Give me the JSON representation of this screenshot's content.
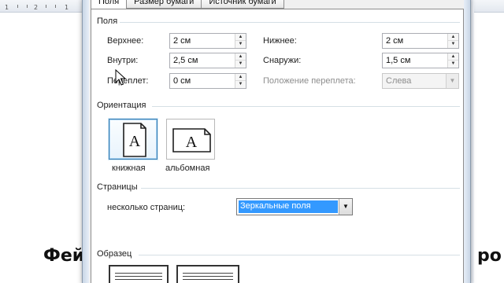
{
  "ruler": {
    "ticks": [
      "1",
      "2",
      "1"
    ]
  },
  "document": {
    "heading_left": "Фей",
    "heading_right": "ро"
  },
  "dialog": {
    "tabs": [
      {
        "label": "Поля",
        "active": true
      },
      {
        "label": "Размер бумаги",
        "active": false
      },
      {
        "label": "Источник бумаги",
        "active": false
      }
    ],
    "margins": {
      "title": "Поля",
      "top_label": "Верхнее:",
      "top_value": "2 см",
      "bottom_label": "Нижнее:",
      "bottom_value": "2 см",
      "inside_label": "Внутри:",
      "inside_value": "2,5 см",
      "outside_label": "Снаружи:",
      "outside_value": "1,5 см",
      "gutter_label": "Переплет:",
      "gutter_value": "0 см",
      "gutter_position_label": "Положение переплета:",
      "gutter_position_value": "Слева"
    },
    "orientation": {
      "title": "Ориентация",
      "portrait_label": "книжная",
      "landscape_label": "альбомная",
      "glyph": "A",
      "selected": "книжная"
    },
    "pages": {
      "title": "Страницы",
      "multiple_label": "несколько страниц:",
      "multiple_value": "Зеркальные поля"
    },
    "preview": {
      "title": "Образец"
    }
  },
  "colors": {
    "selection": "#3399ff",
    "selected_border": "#3c7fb1",
    "group_line": "#d5dfe5",
    "disabled_text": "#8d8d8d"
  }
}
